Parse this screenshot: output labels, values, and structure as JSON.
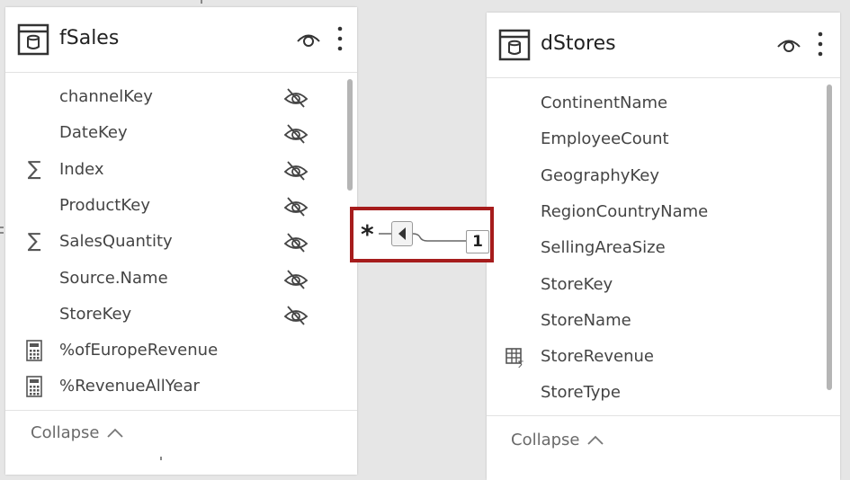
{
  "fsales": {
    "title": "fSales",
    "fields": [
      {
        "label": "channelKey",
        "icon": "none",
        "hidden": true
      },
      {
        "label": "DateKey",
        "icon": "none",
        "hidden": true
      },
      {
        "label": "Index",
        "icon": "sigma",
        "hidden": true
      },
      {
        "label": "ProductKey",
        "icon": "none",
        "hidden": true
      },
      {
        "label": "SalesQuantity",
        "icon": "sigma",
        "hidden": true
      },
      {
        "label": "Source.Name",
        "icon": "none",
        "hidden": true
      },
      {
        "label": "StoreKey",
        "icon": "none",
        "hidden": true
      },
      {
        "label": "%ofEuropeRevenue",
        "icon": "calculator",
        "hidden": false
      },
      {
        "label": "%RevenueAllYear",
        "icon": "calculator",
        "hidden": false
      }
    ],
    "collapse_label": "Collapse"
  },
  "dstores": {
    "title": "dStores",
    "fields": [
      {
        "label": "ContinentName",
        "icon": "none"
      },
      {
        "label": "EmployeeCount",
        "icon": "none"
      },
      {
        "label": "GeographyKey",
        "icon": "none"
      },
      {
        "label": "RegionCountryName",
        "icon": "none"
      },
      {
        "label": "SellingAreaSize",
        "icon": "none"
      },
      {
        "label": "StoreKey",
        "icon": "none"
      },
      {
        "label": "StoreName",
        "icon": "none"
      },
      {
        "label": "StoreRevenue",
        "icon": "table-sigma"
      },
      {
        "label": "StoreType",
        "icon": "none"
      }
    ],
    "collapse_label": "Collapse"
  },
  "relationship": {
    "many_side": "*",
    "one_side": "1",
    "highlight_color": "#a61c1c"
  }
}
